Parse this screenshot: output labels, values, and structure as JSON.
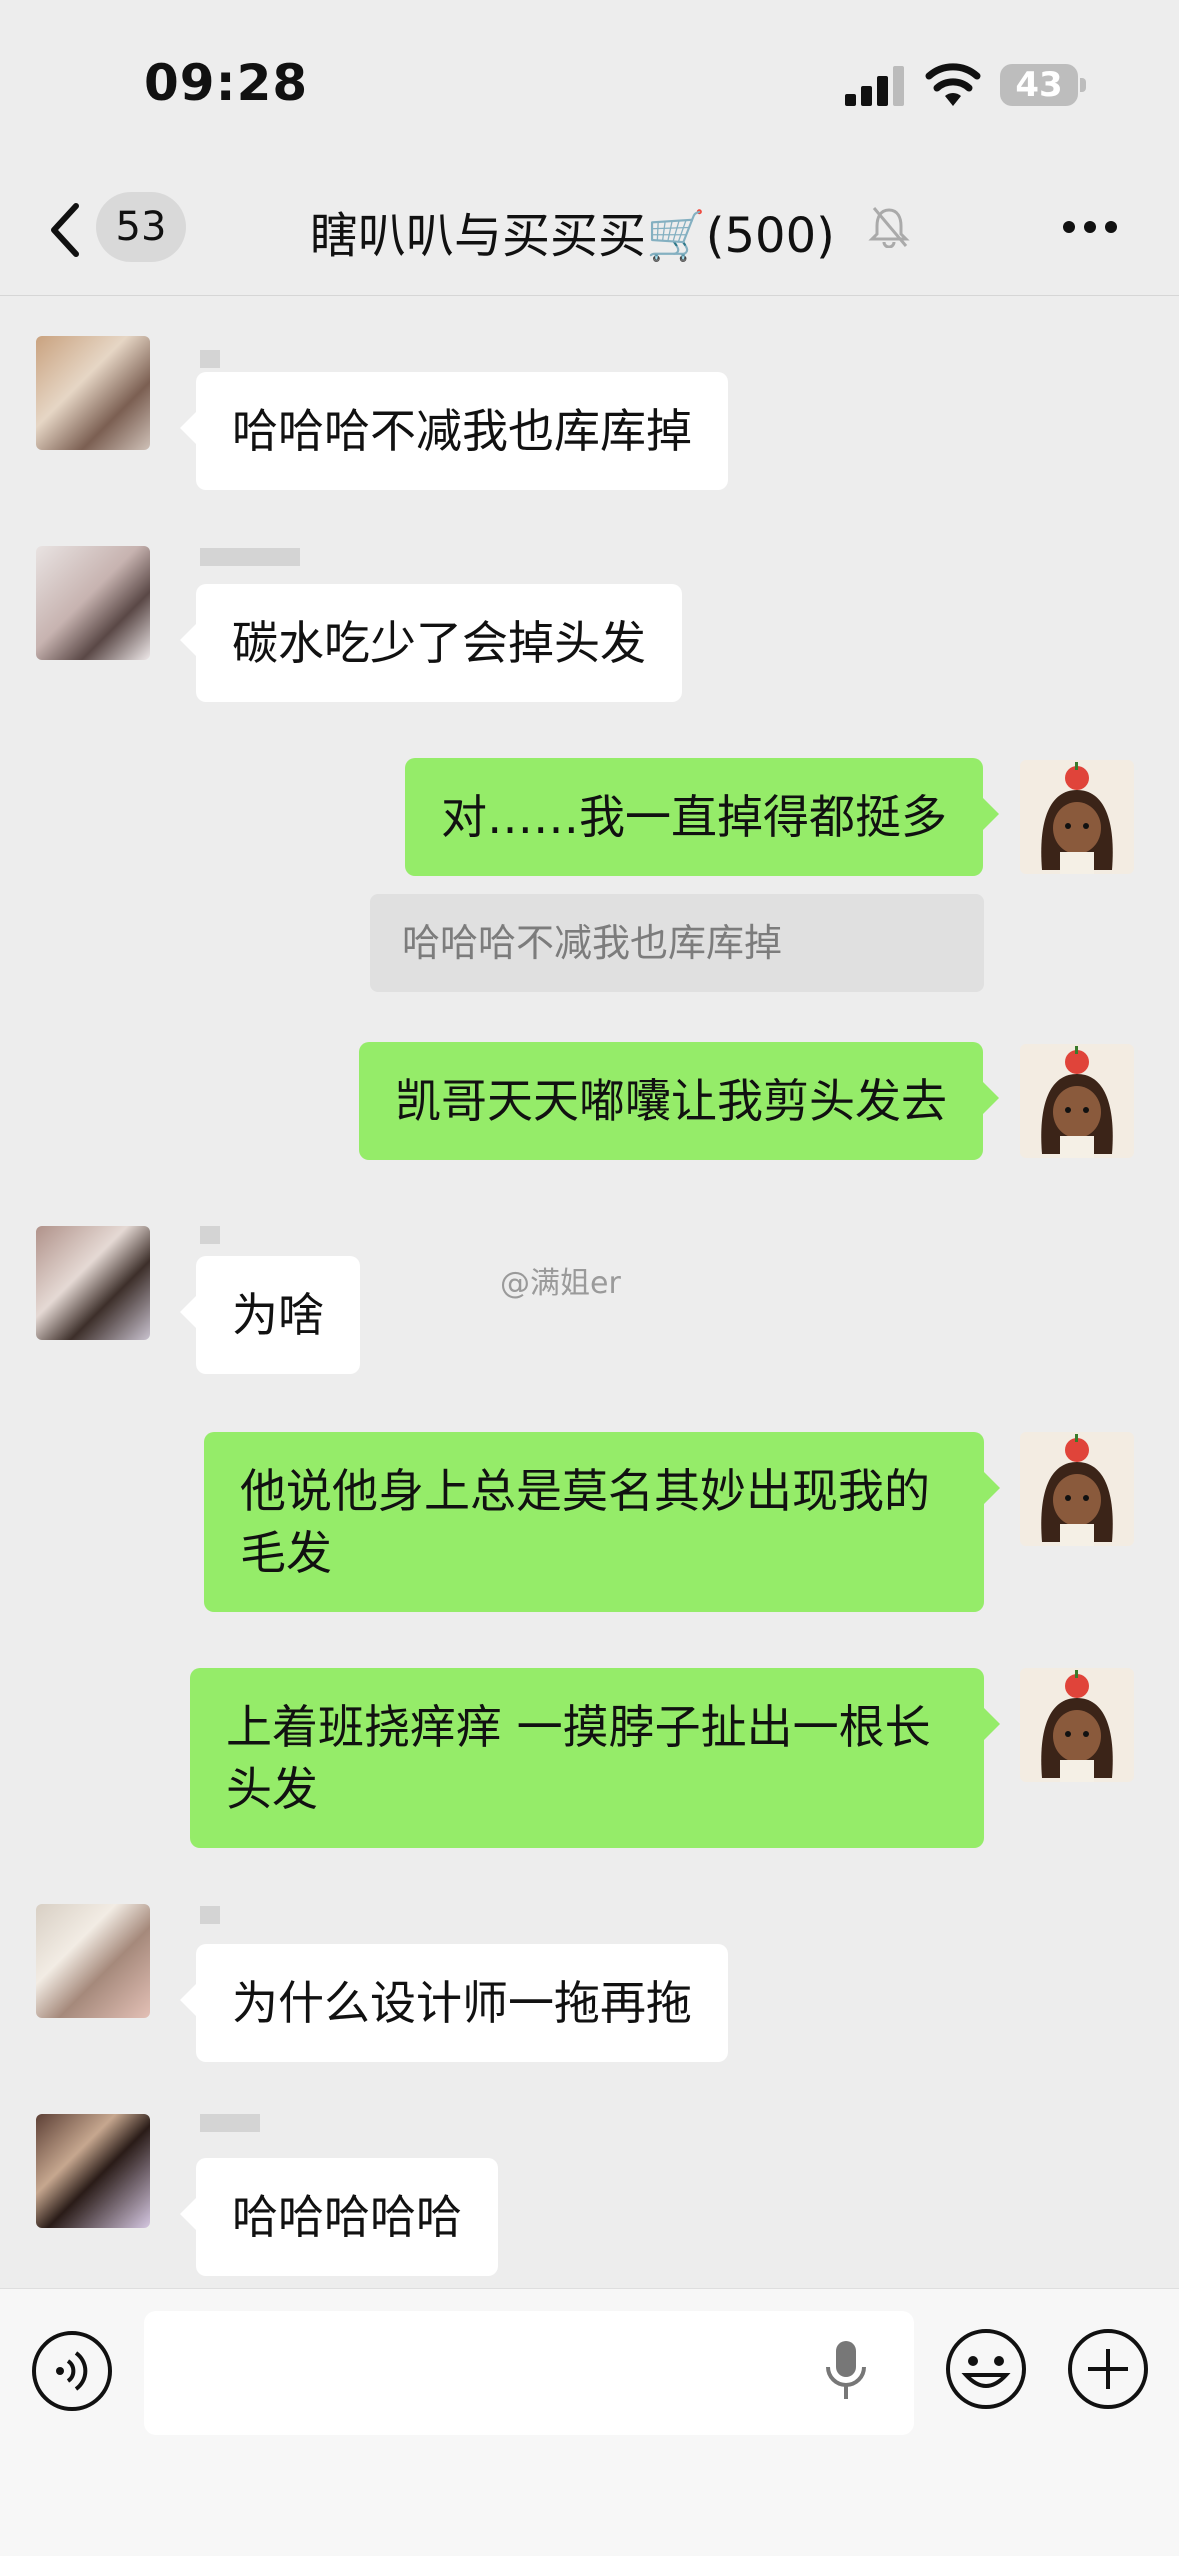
{
  "status_bar": {
    "time": "09:28",
    "battery": "43"
  },
  "nav": {
    "unread_count": "53",
    "title": "瞎叭叭与买买买🛒(500)"
  },
  "messages": [
    {
      "side": "in",
      "text": "哈哈哈不减我也库库掉"
    },
    {
      "side": "in",
      "text": "碳水吃少了会掉头发"
    },
    {
      "side": "out",
      "text": "对……我一直掉得都挺多"
    },
    {
      "side": "quote",
      "text": "哈哈哈不减我也库库掉"
    },
    {
      "side": "out",
      "text": "凯哥天天嘟囔让我剪头发去"
    },
    {
      "side": "in",
      "text": "为啥"
    },
    {
      "side": "out",
      "text": "他说他身上总是莫名其妙出现我的毛发"
    },
    {
      "side": "out",
      "text": "上着班挠痒痒 一摸脖子扯出一根长头发"
    },
    {
      "side": "in",
      "text": "为什么设计师一拖再拖"
    },
    {
      "side": "in",
      "text": "哈哈哈哈哈"
    }
  ],
  "watermark": "@满姐er",
  "colors": {
    "outgoing": "#95ec69",
    "incoming": "#ffffff",
    "background": "#ededed"
  }
}
